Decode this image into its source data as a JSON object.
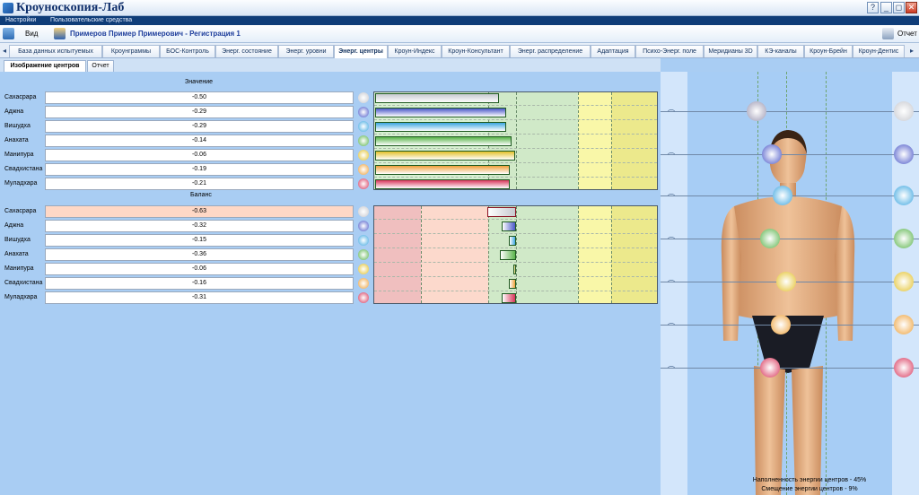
{
  "window": {
    "title": "Кроуноскопия-Лаб",
    "help_btn": "?",
    "min_btn": "_",
    "max_btn": "◻",
    "close_btn": "✕"
  },
  "menu": [
    "Настройки",
    "Пользовательские средства"
  ],
  "toolbar": {
    "view_label": "Вид",
    "patient": "Примеров Пример Примерович - Регистрация 1",
    "report_label": "Отчет"
  },
  "tabs": [
    "База данных испытуемых",
    "Кроунграммы",
    "БОС-Контроль",
    "Энерг. состояние",
    "Энерг. уровни",
    "Энерг. центры",
    "Кроун-Индекс",
    "Кроун-Консультант",
    "Энерг. распределение",
    "Адаптация",
    "Психо-Энерг. поле",
    "Меридианы 3D",
    "КЭ-каналы",
    "Кроун-Брейн",
    "Кроун-Дентис"
  ],
  "active_tab": "Энерг. центры",
  "subtabs": [
    "Изображение центров",
    "Отчет"
  ],
  "value_section": {
    "title": "Значение",
    "rows": [
      {
        "label": "Сахасрара",
        "value": "-0.50"
      },
      {
        "label": "Аджна",
        "value": "-0.29"
      },
      {
        "label": "Вишудха",
        "value": "-0.29"
      },
      {
        "label": "Анахата",
        "value": "-0.14"
      },
      {
        "label": "Манипура",
        "value": "-0.06"
      },
      {
        "label": "Свадхистана",
        "value": "-0.19"
      },
      {
        "label": "Муладхара",
        "value": "-0.21"
      }
    ]
  },
  "balance_section": {
    "title": "Баланс",
    "rows": [
      {
        "label": "Сахасрара",
        "value": "-0.63"
      },
      {
        "label": "Аджна",
        "value": "-0.32"
      },
      {
        "label": "Вишудха",
        "value": "-0.15"
      },
      {
        "label": "Анахата",
        "value": "-0.36"
      },
      {
        "label": "Манипура",
        "value": "-0.06"
      },
      {
        "label": "Свадхистана",
        "value": "-0.16"
      },
      {
        "label": "Муладхара",
        "value": "-0.31"
      }
    ]
  },
  "chakra_colors": [
    "#c7c9cf",
    "#4a57c8",
    "#3ca6e0",
    "#59b34a",
    "#e3c12a",
    "#eea13a",
    "#d8355a"
  ],
  "footer": {
    "fill": "Наполненность энергии центров - 45%",
    "shift": "Смещение энергии центров - 9%"
  }
}
